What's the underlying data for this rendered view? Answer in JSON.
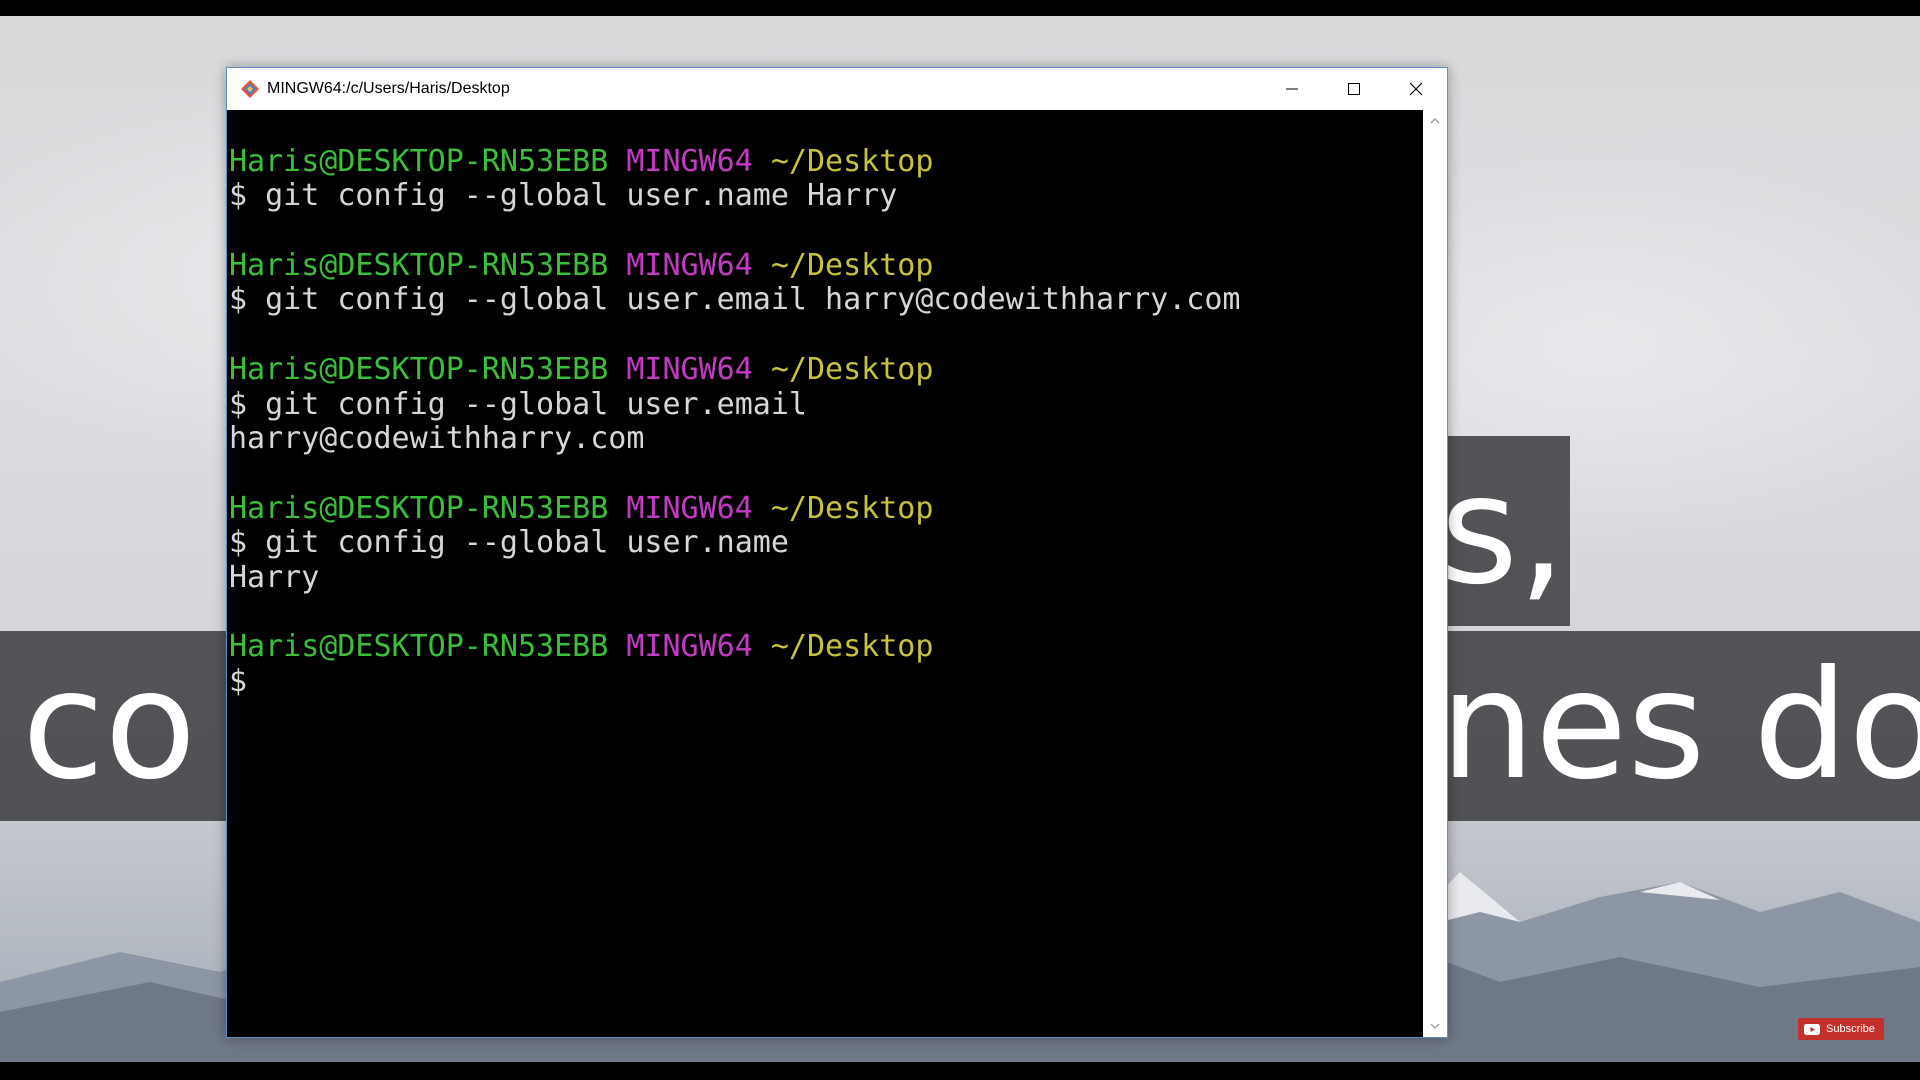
{
  "window": {
    "title": "MINGW64:/c/Users/Haris/Desktop"
  },
  "terminal": {
    "lines": [
      {
        "kind": "blank"
      },
      {
        "kind": "prompt",
        "user": "Haris@DESKTOP-RN53EBB",
        "system": "MINGW64",
        "path": "~/Desktop"
      },
      {
        "kind": "text",
        "text": "$ git config --global user.name Harry"
      },
      {
        "kind": "blank"
      },
      {
        "kind": "prompt",
        "user": "Haris@DESKTOP-RN53EBB",
        "system": "MINGW64",
        "path": "~/Desktop"
      },
      {
        "kind": "text",
        "text": "$ git config --global user.email harry@codewithharry.com"
      },
      {
        "kind": "blank"
      },
      {
        "kind": "prompt",
        "user": "Haris@DESKTOP-RN53EBB",
        "system": "MINGW64",
        "path": "~/Desktop"
      },
      {
        "kind": "text",
        "text": "$ git config --global user.email"
      },
      {
        "kind": "text",
        "text": "harry@codewithharry.com"
      },
      {
        "kind": "blank"
      },
      {
        "kind": "prompt",
        "user": "Haris@DESKTOP-RN53EBB",
        "system": "MINGW64",
        "path": "~/Desktop"
      },
      {
        "kind": "text",
        "text": "$ git config --global user.name"
      },
      {
        "kind": "text",
        "text": "Harry"
      },
      {
        "kind": "blank"
      },
      {
        "kind": "prompt",
        "user": "Haris@DESKTOP-RN53EBB",
        "system": "MINGW64",
        "path": "~/Desktop"
      },
      {
        "kind": "text",
        "text": "$"
      }
    ],
    "colors": {
      "user": "#3bbf3b",
      "system": "#c23bc2",
      "path": "#c6c23b",
      "text": "#d6d6d6",
      "background": "#000000"
    }
  },
  "background_overlay": {
    "left_fragment": "co",
    "right_fragment": "nes do.",
    "upper_fragment": "s,"
  },
  "subscribe_label": "Subscribe",
  "icons": {
    "app": "git-bash-icon",
    "minimize": "minimize-icon",
    "maximize": "maximize-icon",
    "close": "close-icon",
    "scroll_up": "chevron-up-icon",
    "scroll_down": "chevron-down-icon",
    "youtube": "youtube-icon"
  }
}
